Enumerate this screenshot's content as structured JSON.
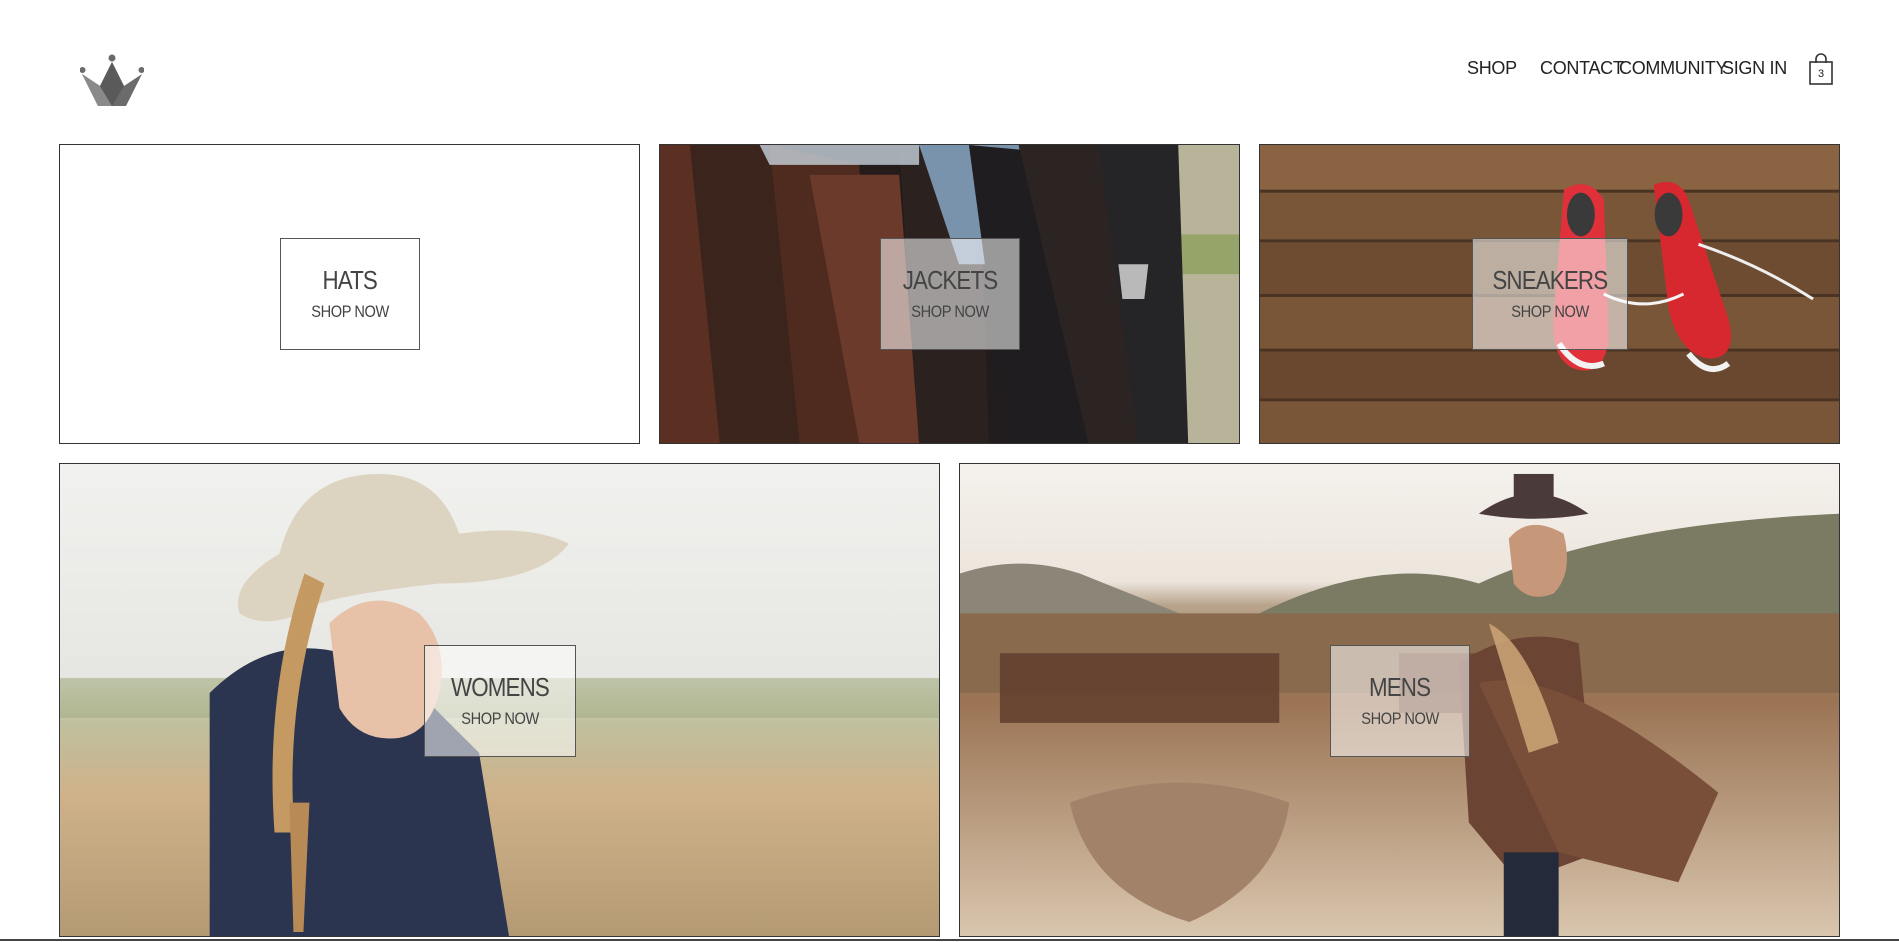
{
  "header": {
    "logo_icon": "crown-icon",
    "nav": [
      {
        "label": "SHOP"
      },
      {
        "label": "CONTACT"
      },
      {
        "label": "COMMUNITY"
      },
      {
        "label": "SIGN IN"
      }
    ],
    "cart": {
      "icon": "shopping-bag-icon",
      "count": "3"
    }
  },
  "categories": [
    {
      "title": "HATS",
      "cta": "SHOP NOW",
      "image": "none"
    },
    {
      "title": "JACKETS",
      "cta": "SHOP NOW",
      "image": "leather-jackets-photo"
    },
    {
      "title": "SNEAKERS",
      "cta": "SHOP NOW",
      "image": "red-sneakers-on-wood-photo"
    },
    {
      "title": "WOMENS",
      "cta": "SHOP NOW",
      "image": "woman-in-cowboy-hat-photo"
    },
    {
      "title": "MENS",
      "cta": "SHOP NOW",
      "image": "cowboy-in-poncho-photo"
    }
  ],
  "colors": {
    "border": "#333333",
    "text": "#444444",
    "logo": "#6b6b6b"
  }
}
